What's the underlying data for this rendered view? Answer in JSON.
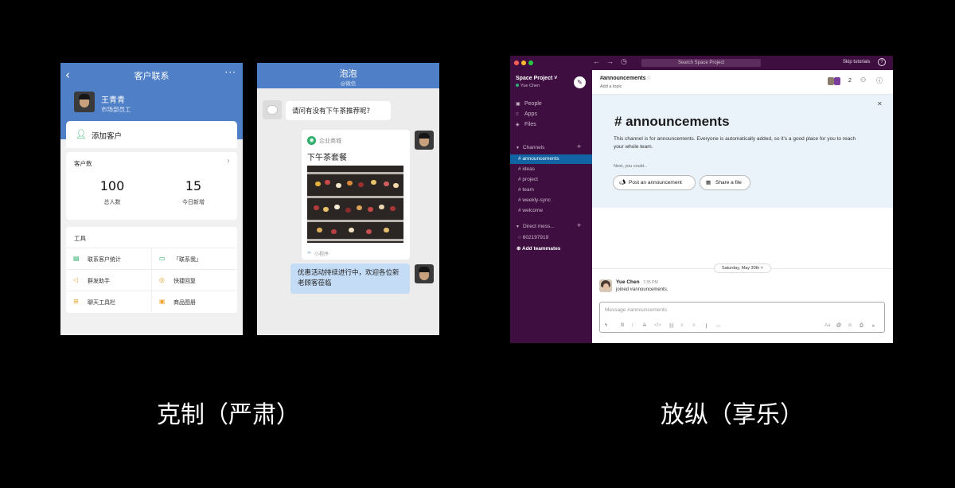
{
  "left_caption": "克制（严肃）",
  "right_caption": "放纵（享乐）",
  "contacts": {
    "title": "客户联系",
    "back_icon": "chevron-left-icon",
    "more_label": "···",
    "user_name": "王青青",
    "user_role": "市场部员工",
    "add_label": "添加客户",
    "stats_title": "客户数",
    "stats": [
      {
        "value": "100",
        "label": "总人数"
      },
      {
        "value": "15",
        "label": "今日新增"
      }
    ],
    "tools_title": "工具",
    "tools": [
      {
        "label": "联系客户统计",
        "icon": "chart-icon",
        "color": "#2aae67"
      },
      {
        "label": "「联系我」",
        "icon": "chat-icon",
        "color": "#2aae67"
      },
      {
        "label": "群发助手",
        "icon": "megaphone-icon",
        "color": "#f0a630"
      },
      {
        "label": "快捷回复",
        "icon": "quick-reply-icon",
        "color": "#f0a630"
      },
      {
        "label": "聊天工具栏",
        "icon": "toolbar-icon",
        "color": "#f0a630"
      },
      {
        "label": "商品图册",
        "icon": "album-icon",
        "color": "#f0a630"
      }
    ],
    "header_color": "#4f7fc6"
  },
  "chat": {
    "title": "泡泡",
    "subtitle": "@微信",
    "question": "请问有没有下午茶推荐呢?",
    "card_shop": "企业商城",
    "card_title": "下午茶套餐",
    "card_footer": "小程序",
    "promo": "优惠活动持续进行中，欢迎各位新老顾客莅临"
  },
  "slack": {
    "search_placeholder": "Search Space Project",
    "skip_label": "Skip tutorials",
    "help_label": "?",
    "workspace_name": "Space Project",
    "workspace_user": "Yue Chen",
    "nav_links": [
      "People",
      "Apps",
      "Files"
    ],
    "channels_label": "Channels",
    "channels": [
      "# announcements",
      "# ideas",
      "# project",
      "# team",
      "# weekly-sync",
      "# welcome"
    ],
    "active_channel_index": 0,
    "dm_label": "Direct mess...",
    "dm_items": [
      "602197919"
    ],
    "add_teammates": "Add teammates",
    "channel_name": "#announcements",
    "add_topic": "Add a topic",
    "member_count": "2",
    "intro_title": "# announcements",
    "intro_text": "This channel is for announcements. Everyone is automatically added, so it’s a good place for you to reach your whole team.",
    "next_label": "Next, you could...",
    "btn_post": "Post an announcement",
    "btn_share": "Share a file",
    "date_label": "Saturday, May 30th",
    "message_author": "Yue Chen",
    "message_time": "7:35 PM",
    "message_text": "joined #announcements.",
    "composer_placeholder": "Message #announcements",
    "sidebar_color": "#3f0e40",
    "active_color": "#1164a3"
  }
}
